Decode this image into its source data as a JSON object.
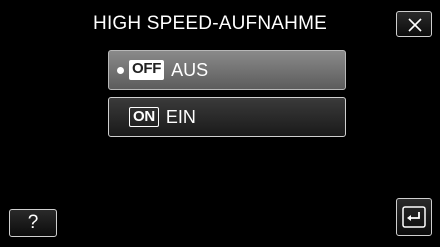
{
  "header": {
    "title": "HIGH SPEED-AUFNAHME",
    "close_icon": "close-icon"
  },
  "options": [
    {
      "badge": "OFF",
      "label": "AUS",
      "selected": true
    },
    {
      "badge": "ON",
      "label": "EIN",
      "selected": false
    }
  ],
  "footer": {
    "help_label": "?",
    "back_icon": "return-icon"
  },
  "colors": {
    "background": "#000000",
    "selected_option": "#7a7a7a",
    "button_border": "#cfcfcf",
    "text": "#ffffff"
  }
}
